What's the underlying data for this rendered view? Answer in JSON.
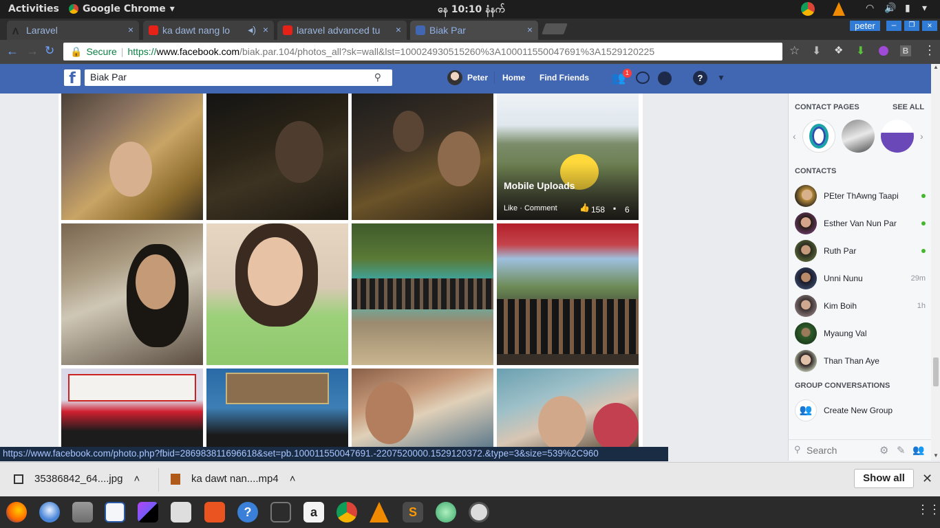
{
  "system_bar": {
    "activities": "Activities",
    "app_name": "Google Chrome",
    "app_menu_icon": "chevron-down-icon",
    "clock": "နေ 10:10 နံနက်"
  },
  "tabs": [
    {
      "title": "Laravel",
      "favicon": "laravel-icon"
    },
    {
      "title": "ka dawt nang lo",
      "favicon": "youtube-icon",
      "audio": true
    },
    {
      "title": "laravel advanced tu",
      "favicon": "youtube-icon"
    },
    {
      "title": "Biak Par",
      "favicon": "facebook-icon",
      "active": true
    }
  ],
  "profile_badge": "peter",
  "address_bar": {
    "secure_label": "Secure",
    "url_scheme": "https://",
    "url_host": "www.facebook.com",
    "url_rest": "/biak.par.104/photos_all?sk=wall&lst=100024930515260%3A100011550047691%3A1529120225"
  },
  "facebook_nav": {
    "search_value": "Biak Par",
    "profile_name": "Peter",
    "home": "Home",
    "find_friends": "Find Friends",
    "friend_requests_count": "1"
  },
  "photo_overlay": {
    "album_title": "Mobile Uploads",
    "actions": "Like · Comment",
    "likes": "158",
    "comments": "6"
  },
  "sidebar": {
    "contact_pages_header": "CONTACT PAGES",
    "see_all": "SEE ALL",
    "contacts_header": "CONTACTS",
    "contacts": [
      {
        "name": "PEter ThAwng Taapi",
        "status": "online"
      },
      {
        "name": "Esther Van Nun Par",
        "status": "online"
      },
      {
        "name": "Ruth Par",
        "status": "online"
      },
      {
        "name": "Unni Nunu",
        "status": "29m"
      },
      {
        "name": "Kim Boih",
        "status": "1h"
      },
      {
        "name": "Myaung Val",
        "status": ""
      },
      {
        "name": "Than Than Aye",
        "status": ""
      }
    ],
    "group_conversations_header": "GROUP CONVERSATIONS",
    "create_group": "Create New Group",
    "search_placeholder": "Search"
  },
  "status_url": "https://www.facebook.com/photo.php?fbid=286983811696618&set=pb.100011550047691.-2207520000.1529120372.&type=3&size=539%2C960",
  "downloads": [
    {
      "name": "35386842_64....jpg"
    },
    {
      "name": "ka dawt nan....mp4"
    }
  ],
  "show_all": "Show all",
  "colors": {
    "facebook_blue": "#4267b2",
    "online_green": "#42b72a",
    "chrome_dark": "#2d2d2d"
  }
}
